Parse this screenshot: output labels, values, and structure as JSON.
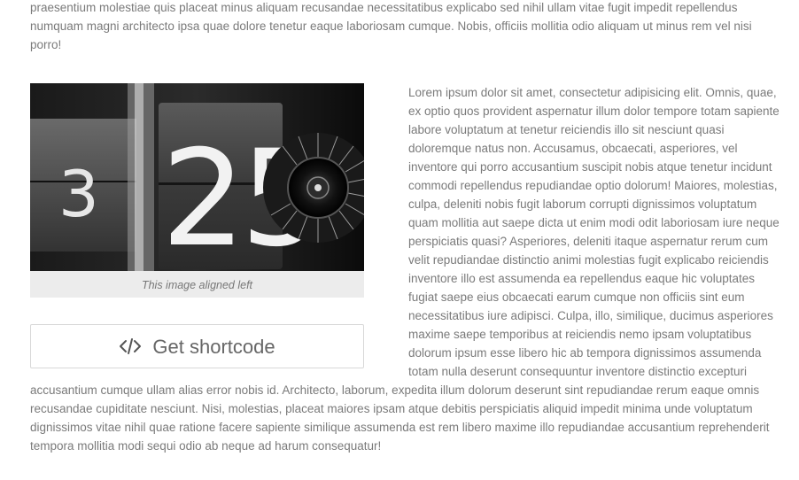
{
  "intro_text": "praesentium molestiae quis placeat minus aliquam recusandae necessitatibus explicabo sed nihil ullam vitae fugit impedit repellendus numquam magni architecto ipsa quae dolore tenetur eaque laboriosam cumque. Nobis, officiis mollitia odio aliquam ut minus rem vel nisi porro!",
  "figure": {
    "caption": "This image aligned left",
    "image_digits": "25",
    "image_side_digit": "3"
  },
  "shortcode_button": {
    "label": "Get shortcode",
    "icon": "code-icon"
  },
  "body_text": "Lorem ipsum dolor sit amet, consectetur adipisicing elit. Omnis, quae, ex optio quos provident aspernatur illum dolor tempore totam sapiente labore voluptatum at tenetur reiciendis illo sit nesciunt quasi doloremque natus non. Accusamus, obcaecati, asperiores, vel inventore qui porro accusantium suscipit nobis atque tenetur incidunt commodi repellendus repudiandae optio dolorum! Maiores, molestias, culpa, deleniti nobis fugit laborum corrupti dignissimos voluptatum quam mollitia aut saepe dicta ut enim modi odit laboriosam iure neque perspiciatis quasi? Asperiores, deleniti itaque aspernatur rerum cum velit repudiandae distinctio animi molestias fugit explicabo reiciendis inventore illo est assumenda ea repellendus eaque hic voluptates fugiat saepe eius obcaecati earum cumque non officiis sint eum necessitatibus iure adipisci. Culpa, illo, similique, ducimus asperiores maxime saepe temporibus at reiciendis nemo ipsam voluptatibus dolorum ipsum esse libero hic ab tempora dignissimos assumenda totam nulla deserunt consequuntur inventore distinctio excepturi accusantium cumque ullam alias error nobis id. Architecto, laborum, expedita illum dolorum deserunt sint repudiandae rerum eaque omnis recusandae cupiditate nesciunt. Nisi, molestias, placeat maiores ipsam atque debitis perspiciatis aliquid impedit minima unde voluptatum dignissimos vitae nihil quae ratione facere sapiente similique assumenda est rem libero maxime illo repudiandae accusantium reprehenderit tempora mollitia modi sequi odio ab neque ad harum consequatur!"
}
